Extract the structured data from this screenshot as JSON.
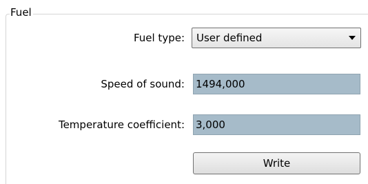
{
  "group": {
    "title": "Fuel"
  },
  "fuel_type": {
    "label": "Fuel type:",
    "selected": "User defined"
  },
  "speed_of_sound": {
    "label": "Speed of sound:",
    "value": "1494,000"
  },
  "temperature_coefficient": {
    "label": "Temperature coefficient:",
    "value": "3,000"
  },
  "write_button": {
    "label": "Write"
  },
  "icons": {
    "dropdown": "chevron-down-icon"
  },
  "colors": {
    "field_background": "#a6bbc9",
    "group_border": "#d5d5d5"
  }
}
